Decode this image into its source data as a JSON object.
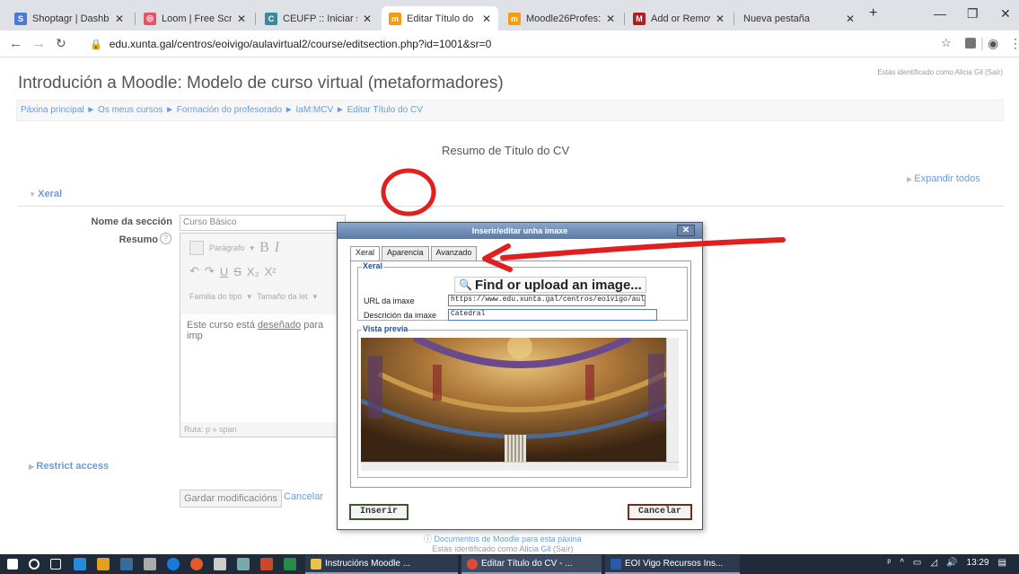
{
  "browser": {
    "tabs": [
      {
        "label": "Shoptagr | Dashbo",
        "color": "#4a7bd0",
        "glyph": "S"
      },
      {
        "label": "Loom | Free Scree",
        "color": "#e0566a",
        "glyph": "◎"
      },
      {
        "label": "CEUFP :: Iniciar se",
        "color": "#3a8a9a",
        "glyph": "C"
      },
      {
        "label": "Editar Título do C",
        "color": "#f39c12",
        "glyph": "m"
      },
      {
        "label": "Moodle26Profes:",
        "color": "#f39c12",
        "glyph": "m"
      },
      {
        "label": "Add or Remove Se",
        "color": "#b02020",
        "glyph": "M"
      },
      {
        "label": "Nueva pestaña",
        "color": "",
        "glyph": ""
      }
    ],
    "new_tab": "+",
    "url": "edu.xunta.gal/centros/eoivigo/aulavirtual2/course/editsection.php?id=1001&sr=0"
  },
  "page": {
    "logged_in_top": "Estás identificado como Alicia Gil (Saír)",
    "title": "Introdución a Moodle: Modelo de curso virtual (metaformadores)",
    "breadcrumb": "Páxina principal ► Os meus cursos ► Formación do profesorado ► IaM:MCV ► Editar Título do CV",
    "section_title": "Resumo de Título do CV",
    "expand_all": "Expandir todos",
    "general_legend": "Xeral",
    "name_label": "Nome da sección",
    "name_value": "Curso Básico",
    "summary_label": "Resumo",
    "toolbar_para": "Parágrafo",
    "toolbar_font": "Familia do tipo",
    "toolbar_size": "Tamaño da let",
    "editor_text_pre": "Este curso está ",
    "editor_text_word": "deseñado",
    "editor_text_post": " para imp",
    "editor_path": "Ruta: p » span",
    "restrict": "Restrict access",
    "save": "Gardar modificacións",
    "cancel": "Cancelar",
    "footer_docs": "Documentos de Moodle para esta páxina",
    "footer_logged_prefix": "Estás identificado como ",
    "footer_user": "Alicia Gil",
    "footer_logout": " (Saír)"
  },
  "dialog": {
    "title": "Inserir/editar unha imaxe",
    "tabs": [
      "Xeral",
      "Aparencia",
      "Avanzado"
    ],
    "legend_general": "Xeral",
    "find_upload": "Find or upload an image...",
    "url_label": "URL da imaxe",
    "url_value": "https://www.edu.xunta.gal/centros/eoivigo/aulavirt",
    "desc_label": "Descrición da imaxe",
    "desc_value": "Catedral",
    "legend_preview": "Vista previa",
    "insert": "Inserir",
    "cancel": "Cancelar"
  },
  "taskbar": {
    "tasks": [
      "Instrucións Moodle ...",
      "Editar Título do CV - ...",
      "EOI Vigo Recursos Ins..."
    ],
    "time": "13:29"
  },
  "colors": {
    "link": "#6a9bd8",
    "annotation": "#e02020"
  }
}
